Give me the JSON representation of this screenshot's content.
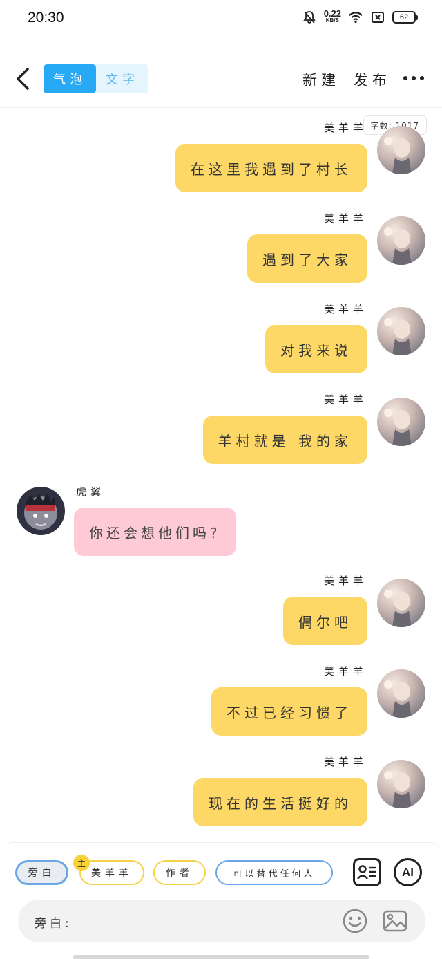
{
  "status_bar": {
    "time": "20:30",
    "net_speed_value": "0.22",
    "net_speed_unit": "KB/S",
    "battery": "62",
    "icons": [
      "bell-off-icon",
      "wifi-icon",
      "close-box-icon",
      "battery-icon"
    ]
  },
  "nav": {
    "tab_bubble": "气泡",
    "tab_text": "文字",
    "new_label": "新建",
    "publish_label": "发布",
    "more_icon": "more-dots-icon",
    "back_icon": "back-chevron-icon"
  },
  "word_count": "字数: 1017",
  "messages": [
    {
      "side": "right",
      "name": "美羊羊",
      "text": "在这里我遇到了村长"
    },
    {
      "side": "right",
      "name": "美羊羊",
      "text": "遇到了大家"
    },
    {
      "side": "right",
      "name": "美羊羊",
      "text": "对我来说"
    },
    {
      "side": "right",
      "name": "美羊羊",
      "text": "羊村就是 我的家"
    },
    {
      "side": "left",
      "name": "虎翼",
      "text": "你还会想他们吗?"
    },
    {
      "side": "right",
      "name": "美羊羊",
      "text": "偶尔吧"
    },
    {
      "side": "right",
      "name": "美羊羊",
      "text": "不过已经习惯了"
    },
    {
      "side": "right",
      "name": "美羊羊",
      "text": "现在的生活挺好的"
    }
  ],
  "bottom": {
    "chips": {
      "narration": "旁白",
      "role": "美羊羊",
      "author": "作者",
      "anyone": "可以替代任何人"
    },
    "host_badge": "主",
    "ai_label": "AI",
    "input_label": "旁白:",
    "input_value": "",
    "icons": [
      "role-card-icon",
      "ai-icon",
      "emoji-icon",
      "image-icon"
    ]
  },
  "colors": {
    "accent_blue": "#27a9f5",
    "bubble_yellow": "#fdd866",
    "bubble_pink": "#fdcad6",
    "chip_yellow": "#f4d34a",
    "chip_blue": "#6ba7e6"
  }
}
